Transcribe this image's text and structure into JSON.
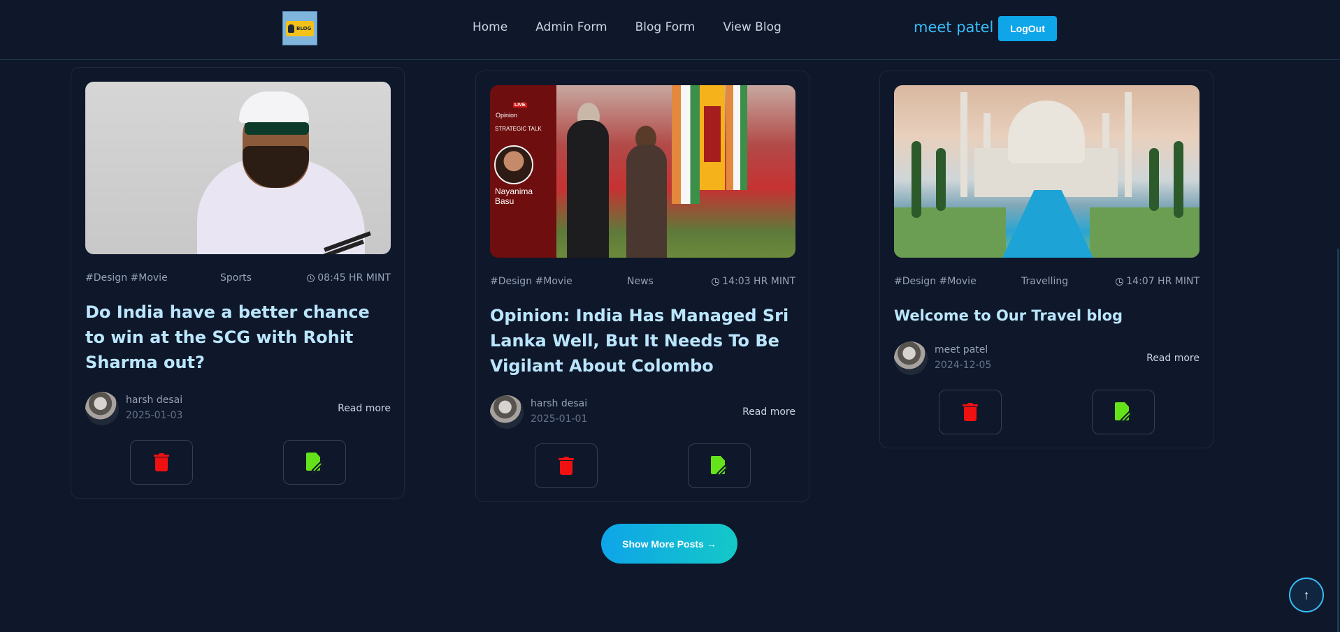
{
  "header": {
    "logo_icon": "blog-logo-icon",
    "logo_text": "BLOG",
    "nav": [
      "Home",
      "Admin Form",
      "Blog Form",
      "View Blog"
    ],
    "user_name": "meet patel",
    "logout_label": "LogOut"
  },
  "posts": [
    {
      "tags": "#Design #Movie",
      "category": "Sports",
      "time": "08:45 HR MINT",
      "title": "Do India have a better chance to win at the SCG with Rohit Sharma out?",
      "author": "harsh desai",
      "date": "2025-01-03",
      "read_more": "Read more",
      "image": "cricket-player-photo"
    },
    {
      "tags": "#Design #Movie",
      "category": "News",
      "time": "14:03 HR MINT",
      "title": "Opinion: India Has Managed Sri Lanka Well, But It Needs To Be Vigilant About Colombo",
      "author": "harsh desai",
      "date": "2025-01-01",
      "read_more": "Read more",
      "image": "news-opinion-photo",
      "image_text": {
        "badge": "LIVE",
        "opinion": "Opinion",
        "strategic": "STRATEGIC TALK",
        "name": "Nayanima Basu"
      }
    },
    {
      "tags": "#Design #Movie",
      "category": "Travelling",
      "time": "14:07 HR MINT",
      "title": "Welcome to Our Travel blog",
      "author": "meet patel",
      "date": "2024-12-05",
      "read_more": "Read more",
      "image": "taj-mahal-photo"
    }
  ],
  "show_more_label": "Show More Posts",
  "show_more_arrow": "→",
  "scroll_top_icon": "↑",
  "colors": {
    "background": "#0f172a",
    "accent": "#38bdf8",
    "title": "#bae6fd",
    "delete": "#ef1111",
    "edit": "#65e31a"
  }
}
